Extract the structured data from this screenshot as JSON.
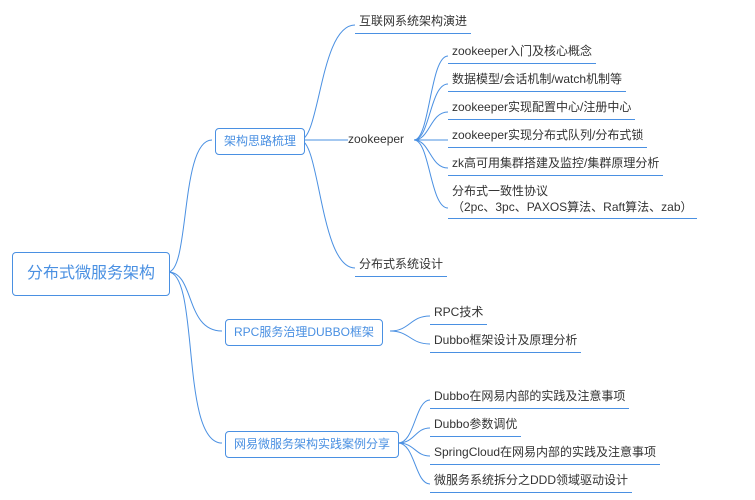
{
  "root": "分布式微服务架构",
  "branches": {
    "b1": {
      "label": "架构思路梳理",
      "items": {
        "i0": "互联网系统架构演进",
        "i1": "zookeeper",
        "i2": "分布式系统设计"
      },
      "zk_items": {
        "z0": "zookeeper入门及核心概念",
        "z1": "数据模型/会话机制/watch机制等",
        "z2": "zookeeper实现配置中心/注册中心",
        "z3": "zookeeper实现分布式队列/分布式锁",
        "z4": "zk高可用集群搭建及监控/集群原理分析",
        "z5_a": "分布式一致性协议",
        "z5_b": "（2pc、3pc、PAXOS算法、Raft算法、zab）"
      }
    },
    "b2": {
      "label": "RPC服务治理DUBBO框架",
      "items": {
        "i0": "RPC技术",
        "i1": "Dubbo框架设计及原理分析"
      }
    },
    "b3": {
      "label": "网易微服务架构实践案例分享",
      "items": {
        "i0": "Dubbo在网易内部的实践及注意事项",
        "i1": "Dubbo参数调优",
        "i2": "SpringCloud在网易内部的实践及注意事项",
        "i3": "微服务系统拆分之DDD领域驱动设计"
      }
    }
  }
}
